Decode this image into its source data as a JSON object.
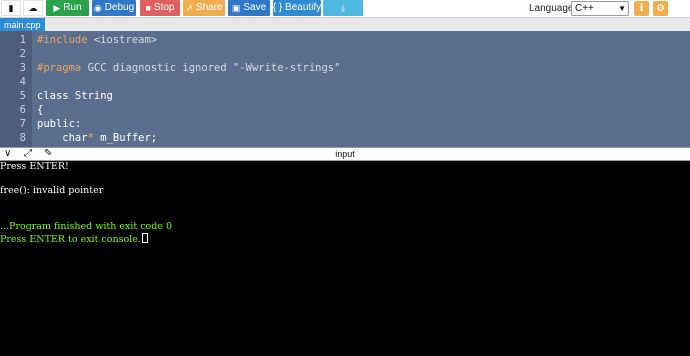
{
  "toolbar": {
    "run_label": "Run",
    "debug_label": "Debug",
    "stop_label": "Stop",
    "share_label": "Share",
    "save_label": "Save",
    "beautify_label": "{ } Beautify",
    "language_label": "Language",
    "language_value": "C++",
    "colors": {
      "run": "#2aa14b",
      "debug": "#2e78c7",
      "stop": "#e06060",
      "share": "#f0ad4e",
      "save": "#2e78c7",
      "beautify": "#2e8bd6",
      "download": "#4fb8e0"
    }
  },
  "tabs": [
    {
      "label": "main.cpp"
    }
  ],
  "editor": {
    "lines": [
      {
        "n": "1",
        "parts": [
          {
            "t": "#include",
            "c": "kw-orange"
          },
          {
            "t": " <iostream>",
            "c": "str-grey"
          }
        ]
      },
      {
        "n": "2",
        "parts": []
      },
      {
        "n": "3",
        "parts": [
          {
            "t": "#pragma",
            "c": "kw-orange"
          },
          {
            "t": " GCC diagnostic ignored \"-Wwrite-strings\"",
            "c": "str-grey"
          }
        ]
      },
      {
        "n": "4",
        "parts": []
      },
      {
        "n": "5",
        "parts": [
          {
            "t": "class String",
            "c": ""
          }
        ]
      },
      {
        "n": "6",
        "parts": [
          {
            "t": "{",
            "c": ""
          }
        ]
      },
      {
        "n": "7",
        "parts": [
          {
            "t": "public:",
            "c": ""
          }
        ]
      },
      {
        "n": "8",
        "parts": [
          {
            "t": "    char",
            "c": ""
          },
          {
            "t": "*",
            "c": "kw-orange"
          },
          {
            "t": " m_Buffer;",
            "c": ""
          }
        ]
      }
    ]
  },
  "console": {
    "title": "input",
    "lines": [
      {
        "text": "Press ENTER!",
        "color": "white"
      },
      {
        "text": "",
        "color": "white"
      },
      {
        "text": "free(): invalid pointer",
        "color": "white"
      },
      {
        "text": "",
        "color": "white"
      },
      {
        "text": "",
        "color": "white"
      },
      {
        "text": "...Program finished with exit code 0",
        "color": "green"
      },
      {
        "text": "Press ENTER to exit console.",
        "color": "green"
      }
    ]
  }
}
